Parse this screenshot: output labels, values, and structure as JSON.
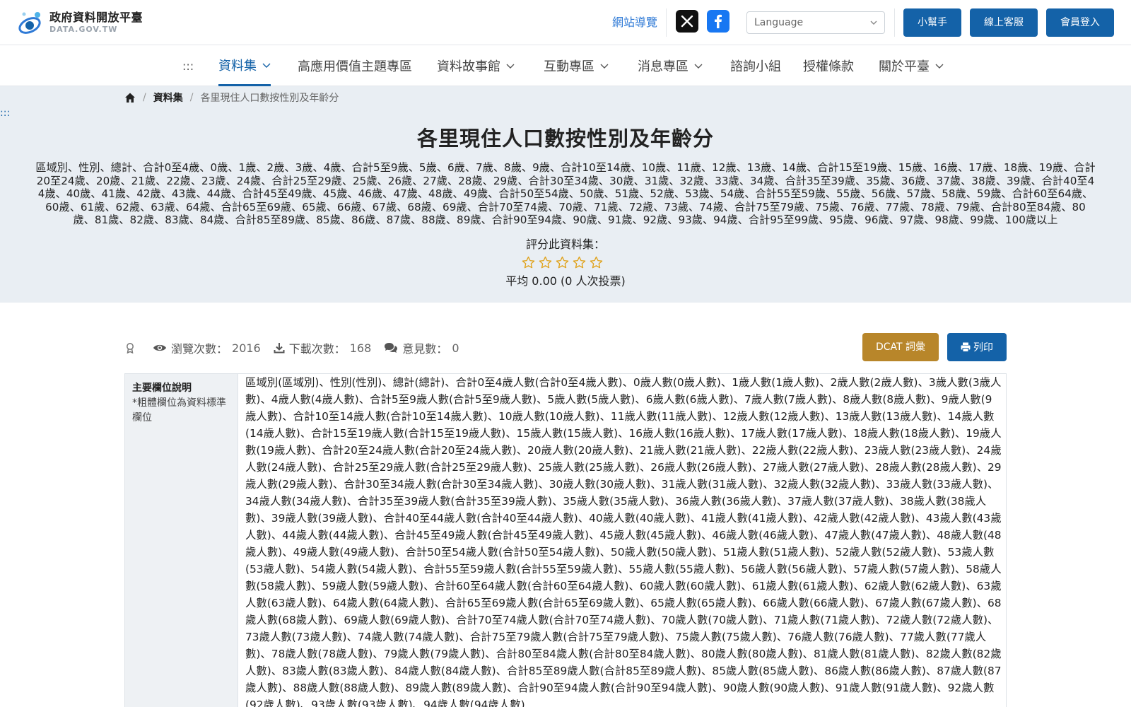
{
  "header": {
    "logo_title": "政府資料開放平臺",
    "logo_sub": "DATA.GOV.TW",
    "site_guide": "網站導覽",
    "language_placeholder": "Language",
    "buttons": {
      "help": "小幫手",
      "customer_service": "線上客服",
      "login": "會員登入"
    }
  },
  "nav": {
    "skip": ":::",
    "items": [
      {
        "label": "資料集"
      },
      {
        "label": "高應用價值主題專區"
      },
      {
        "label": "資料故事館"
      },
      {
        "label": "互動專區"
      },
      {
        "label": "消息專區"
      },
      {
        "label": "諮詢小組"
      },
      {
        "label": "授權條款"
      },
      {
        "label": "關於平臺"
      }
    ]
  },
  "breadcrumb": {
    "sep": "/",
    "items": [
      "資料集",
      "各里現住人口數按性別及年齡分"
    ]
  },
  "skip_marker": ":::",
  "dataset": {
    "title": "各里現住人口數按性別及年齡分",
    "description": "區域別、性別、總計、合計0至4歲、0歲、1歲、2歲、3歲、4歲、合計5至9歲、5歲、6歲、7歲、8歲、9歲、合計10至14歲、10歲、11歲、12歲、13歲、14歲、合計15至19歲、15歲、16歲、17歲、18歲、19歲、合計20至24歲、20歲、21歲、22歲、23歲、24歲、合計25至29歲、25歲、26歲、27歲、28歲、29歲、合計30至34歲、30歲、31歲、32歲、33歲、34歲、合計35至39歲、35歲、36歲、37歲、38歲、39歲、合計40至44歲、40歲、41歲、42歲、43歲、44歲、合計45至49歲、45歲、46歲、47歲、48歲、49歲、合計50至54歲、50歲、51歲、52歲、53歲、54歲、合計55至59歲、55歲、56歲、57歲、58歲、59歲、合計60至64歲、60歲、61歲、62歲、63歲、64歲、合計65至69歲、65歲、66歲、67歲、68歲、69歲、合計70至74歲、70歲、71歲、72歲、73歲、74歲、合計75至79歲、75歲、76歲、77歲、78歲、79歲、合計80至84歲、80歲、81歲、82歲、83歲、84歲、合計85至89歲、85歲、86歲、87歲、88歲、89歲、合計90至94歲、90歲、91歲、92歲、93歲、94歲、合計95至99歲、95歲、96歲、97歲、98歲、99歲、100歲以上",
    "rating_label": "評分此資料集：",
    "rating_value": 0,
    "rating_max": 5,
    "rating_avg": "平均 0.00 (0 人次投票)"
  },
  "stats": {
    "views_label": "瀏覽次數：",
    "views": "2016",
    "downloads_label": "下載次數：",
    "downloads": "168",
    "comments_label": "意見數：",
    "comments": "0"
  },
  "actions": {
    "dcat": "DCAT 詞彙",
    "print": "列印"
  },
  "fields": {
    "head_title": "主要欄位說明",
    "head_note": "*粗體欄位為資料標準欄位",
    "body": "區域別(區域別)、性別(性別)、總計(總計)、合計0至4歲人數(合計0至4歲人數)、0歲人數(0歲人數)、1歲人數(1歲人數)、2歲人數(2歲人數)、3歲人數(3歲人數)、4歲人數(4歲人數)、合計5至9歲人數(合計5至9歲人數)、5歲人數(5歲人數)、6歲人數(6歲人數)、7歲人數(7歲人數)、8歲人數(8歲人數)、9歲人數(9歲人數)、合計10至14歲人數(合計10至14歲人數)、10歲人數(10歲人數)、11歲人數(11歲人數)、12歲人數(12歲人數)、13歲人數(13歲人數)、14歲人數(14歲人數)、合計15至19歲人數(合計15至19歲人數)、15歲人數(15歲人數)、16歲人數(16歲人數)、17歲人數(17歲人數)、18歲人數(18歲人數)、19歲人數(19歲人數)、合計20至24歲人數(合計20至24歲人數)、20歲人數(20歲人數)、21歲人數(21歲人數)、22歲人數(22歲人數)、23歲人數(23歲人數)、24歲人數(24歲人數)、合計25至29歲人數(合計25至29歲人數)、25歲人數(25歲人數)、26歲人數(26歲人數)、27歲人數(27歲人數)、28歲人數(28歲人數)、29歲人數(29歲人數)、合計30至34歲人數(合計30至34歲人數)、30歲人數(30歲人數)、31歲人數(31歲人數)、32歲人數(32歲人數)、33歲人數(33歲人數)、34歲人數(34歲人數)、合計35至39歲人數(合計35至39歲人數)、35歲人數(35歲人數)、36歲人數(36歲人數)、37歲人數(37歲人數)、38歲人數(38歲人數)、39歲人數(39歲人數)、合計40至44歲人數(合計40至44歲人數)、40歲人數(40歲人數)、41歲人數(41歲人數)、42歲人數(42歲人數)、43歲人數(43歲人數)、44歲人數(44歲人數)、合計45至49歲人數(合計45至49歲人數)、45歲人數(45歲人數)、46歲人數(46歲人數)、47歲人數(47歲人數)、48歲人數(48歲人數)、49歲人數(49歲人數)、合計50至54歲人數(合計50至54歲人數)、50歲人數(50歲人數)、51歲人數(51歲人數)、52歲人數(52歲人數)、53歲人數(53歲人數)、54歲人數(54歲人數)、合計55至59歲人數(合計55至59歲人數)、55歲人數(55歲人數)、56歲人數(56歲人數)、57歲人數(57歲人數)、58歲人數(58歲人數)、59歲人數(59歲人數)、合計60至64歲人數(合計60至64歲人數)、60歲人數(60歲人數)、61歲人數(61歲人數)、62歲人數(62歲人數)、63歲人數(63歲人數)、64歲人數(64歲人數)、合計65至69歲人數(合計65至69歲人數)、65歲人數(65歲人數)、66歲人數(66歲人數)、67歲人數(67歲人數)、68歲人數(68歲人數)、69歲人數(69歲人數)、合計70至74歲人數(合計70至74歲人數)、70歲人數(70歲人數)、71歲人數(71歲人數)、72歲人數(72歲人數)、73歲人數(73歲人數)、74歲人數(74歲人數)、合計75至79歲人數(合計75至79歲人數)、75歲人數(75歲人數)、76歲人數(76歲人數)、77歲人數(77歲人數)、78歲人數(78歲人數)、79歲人數(79歲人數)、合計80至84歲人數(合計80至84歲人數)、80歲人數(80歲人數)、81歲人數(81歲人數)、82歲人數(82歲人數)、83歲人數(83歲人數)、84歲人數(84歲人數)、合計85至89歲人數(合計85至89歲人數)、85歲人數(85歲人數)、86歲人數(86歲人數)、87歲人數(87歲人數)、88歲人數(88歲人數)、89歲人數(89歲人數)、合計90至94歲人數(合計90至94歲人數)、90歲人數(90歲人數)、91歲人數(91歲人數)、92歲人數(92歲人數)、93歲人數(93歲人數)、94歲人數(94歲人數)"
  },
  "colors": {
    "brand_blue": "#1462a8",
    "link_blue": "#2f7ad6",
    "dcat_gold": "#b8862a",
    "hero_bg": "#e9eef3",
    "star": "#e0a21a"
  },
  "icons": {
    "logo": "platform-logo-icon",
    "x": "x-twitter-icon",
    "facebook": "facebook-icon",
    "chevron": "chevron-down-icon",
    "home": "home-icon",
    "star": "star-outline-icon",
    "badge": "badge-icon",
    "eye": "eye-icon",
    "download": "download-icon",
    "comments": "comments-icon",
    "print": "print-icon"
  }
}
